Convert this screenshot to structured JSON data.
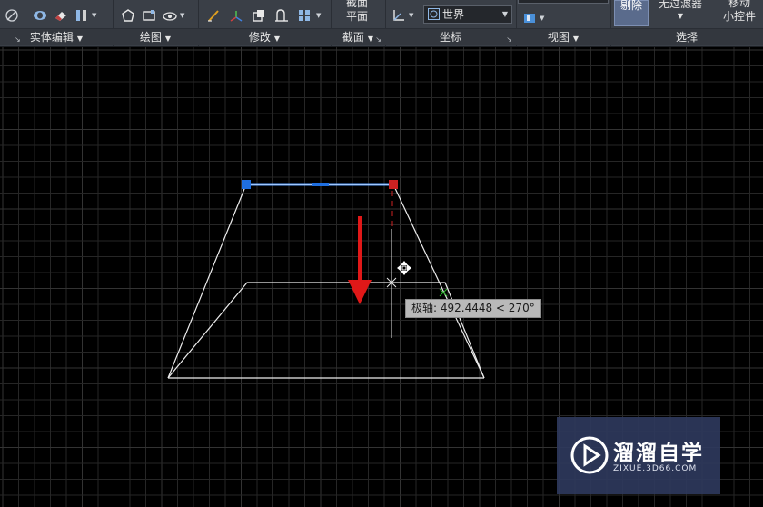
{
  "ribbon": {
    "panels": {
      "solid_edit": "实体编辑",
      "draw": "绘图",
      "modify": "修改",
      "section": "截面",
      "coordinates": "坐标",
      "view": "视图",
      "selection": "选择"
    },
    "section_plane_line1": "截面",
    "section_plane_line2": "平面",
    "coord_system_value": "世界",
    "remove_label": "剔除",
    "no_filter_label": "无过滤器",
    "move_gizmo_line1": "移动",
    "move_gizmo_line2": "小控件"
  },
  "tooltip": {
    "text": "极轴: 492.4448 < 270°"
  },
  "watermark": {
    "name": "溜溜自学",
    "url": "ZIXUE.3D66.COM"
  },
  "colors": {
    "ribbon_bg": "#3a3f47",
    "canvas_bg": "#000000",
    "grid": "#262626",
    "grid_major": "#333333",
    "selected_edge": "#5aa0ff",
    "grip_blue": "#1f6fe0",
    "grip_red": "#cc2222",
    "arrow": "#e01818",
    "watermark_bg": "#2e385c"
  },
  "icons": [
    "orbit-icon",
    "shell-icon",
    "eraser-icon",
    "extract-icon",
    "polygon-icon",
    "rectangle-icon",
    "eye-icon",
    "brush-icon",
    "ucs-icon",
    "fillet-icon",
    "edit-icon",
    "array-icon",
    "ucs-axis-icon",
    "globe-icon",
    "view-cube-icon"
  ]
}
